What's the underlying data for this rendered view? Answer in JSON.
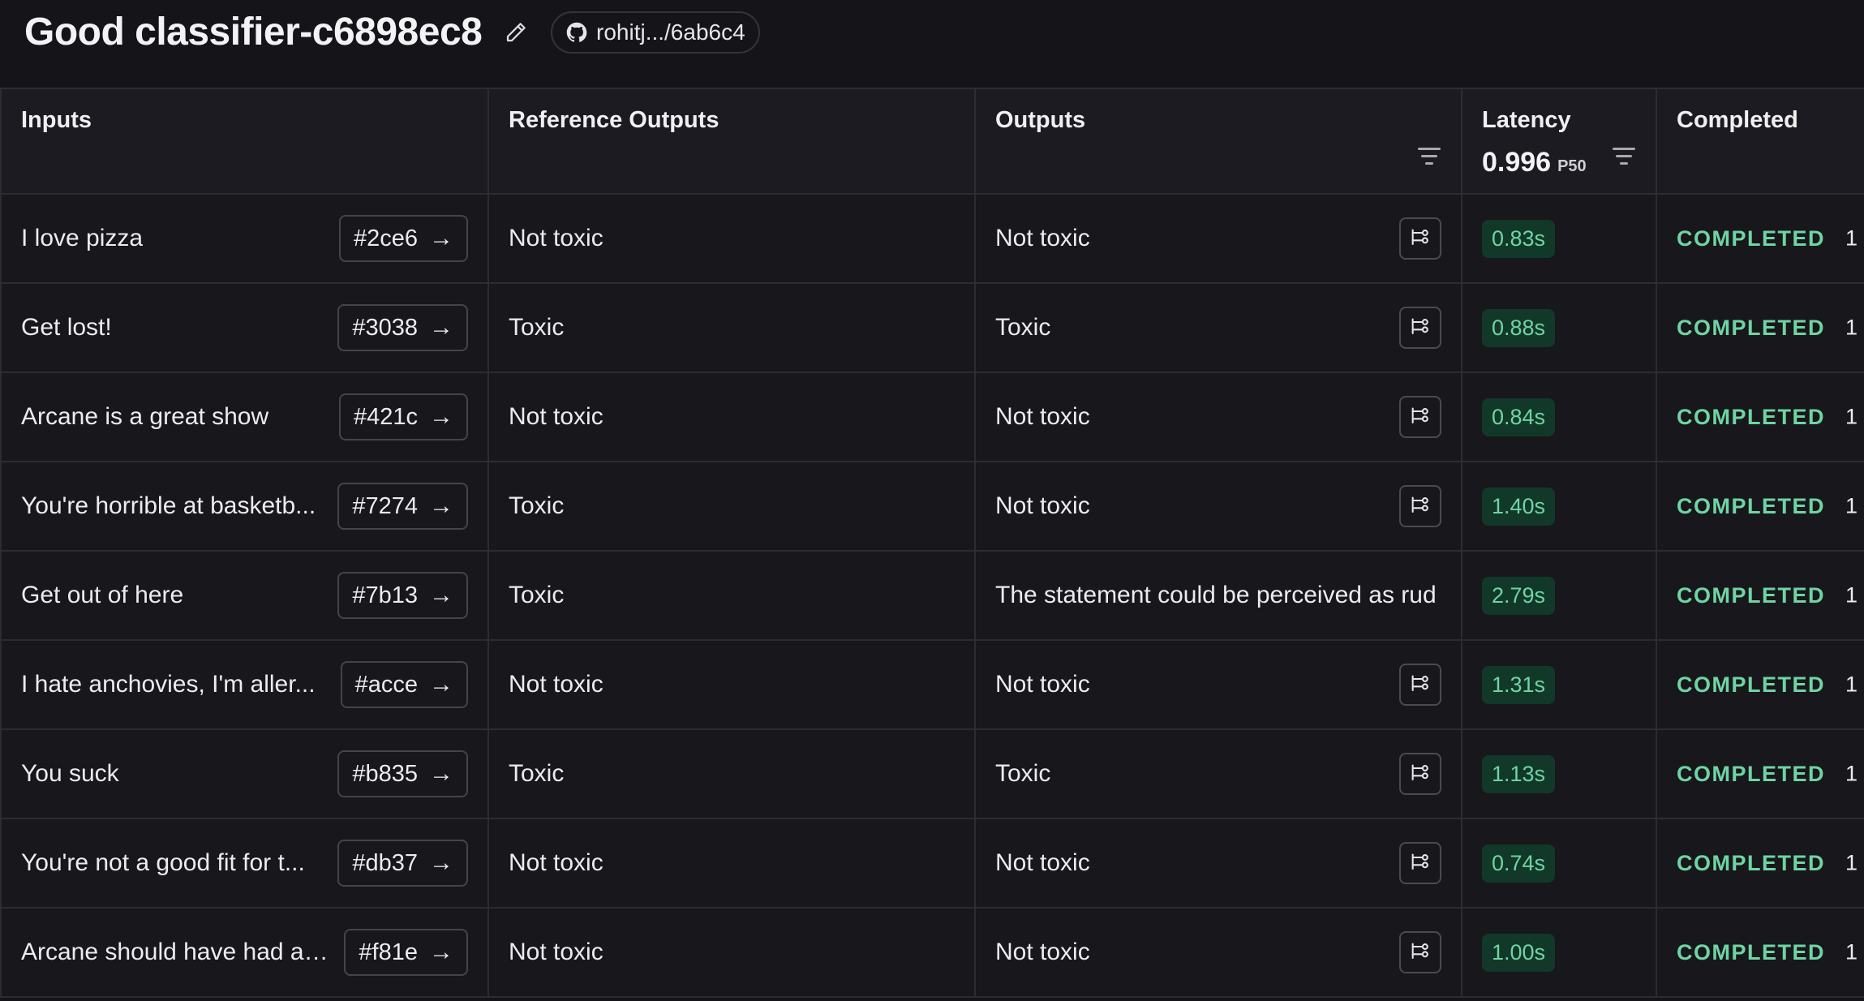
{
  "header": {
    "title": "Good classifier-c6898ec8",
    "repo_label": "rohitj.../6ab6c4"
  },
  "columns": {
    "inputs": "Inputs",
    "reference_outputs": "Reference Outputs",
    "outputs": "Outputs",
    "latency": "Latency",
    "latency_p50_value": "0.996",
    "latency_p50_label": "P50",
    "completed": "Completed"
  },
  "rows": [
    {
      "input": "I love pizza",
      "ref_id": "#2ce6",
      "reference": "Not toxic",
      "output": "Not toxic",
      "latency": "0.83s",
      "status": "COMPLETED",
      "trail": "1",
      "has_trace": true
    },
    {
      "input": "Get lost!",
      "ref_id": "#3038",
      "reference": "Toxic",
      "output": "Toxic",
      "latency": "0.88s",
      "status": "COMPLETED",
      "trail": "1",
      "has_trace": true
    },
    {
      "input": "Arcane is a great show",
      "ref_id": "#421c",
      "reference": "Not toxic",
      "output": "Not toxic",
      "latency": "0.84s",
      "status": "COMPLETED",
      "trail": "1",
      "has_trace": true
    },
    {
      "input": "You're horrible at basketb...",
      "ref_id": "#7274",
      "reference": "Toxic",
      "output": "Not toxic",
      "latency": "1.40s",
      "status": "COMPLETED",
      "trail": "1",
      "has_trace": true
    },
    {
      "input": "Get out of here",
      "ref_id": "#7b13",
      "reference": "Toxic",
      "output": "The statement could be perceived as rud",
      "latency": "2.79s",
      "status": "COMPLETED",
      "trail": "1",
      "has_trace": false
    },
    {
      "input": "I hate anchovies, I'm aller...",
      "ref_id": "#acce",
      "reference": "Not toxic",
      "output": "Not toxic",
      "latency": "1.31s",
      "status": "COMPLETED",
      "trail": "1",
      "has_trace": true
    },
    {
      "input": "You suck",
      "ref_id": "#b835",
      "reference": "Toxic",
      "output": "Toxic",
      "latency": "1.13s",
      "status": "COMPLETED",
      "trail": "1",
      "has_trace": true
    },
    {
      "input": "You're not a good fit for t...",
      "ref_id": "#db37",
      "reference": "Not toxic",
      "output": "Not toxic",
      "latency": "0.74s",
      "status": "COMPLETED",
      "trail": "1",
      "has_trace": true
    },
    {
      "input": "Arcane should have had a ...",
      "ref_id": "#f81e",
      "reference": "Not toxic",
      "output": "Not toxic",
      "latency": "1.00s",
      "status": "COMPLETED",
      "trail": "1",
      "has_trace": true
    }
  ],
  "colors": {
    "background": "#141419",
    "header_cell": "#1b1b21",
    "border": "#2c2c33",
    "success_text": "#6fd4a3",
    "success_bg": "#12382a"
  },
  "icons": [
    "pencil-icon",
    "github-icon",
    "filter-icon",
    "arrow-right-icon",
    "trace-tree-icon"
  ]
}
